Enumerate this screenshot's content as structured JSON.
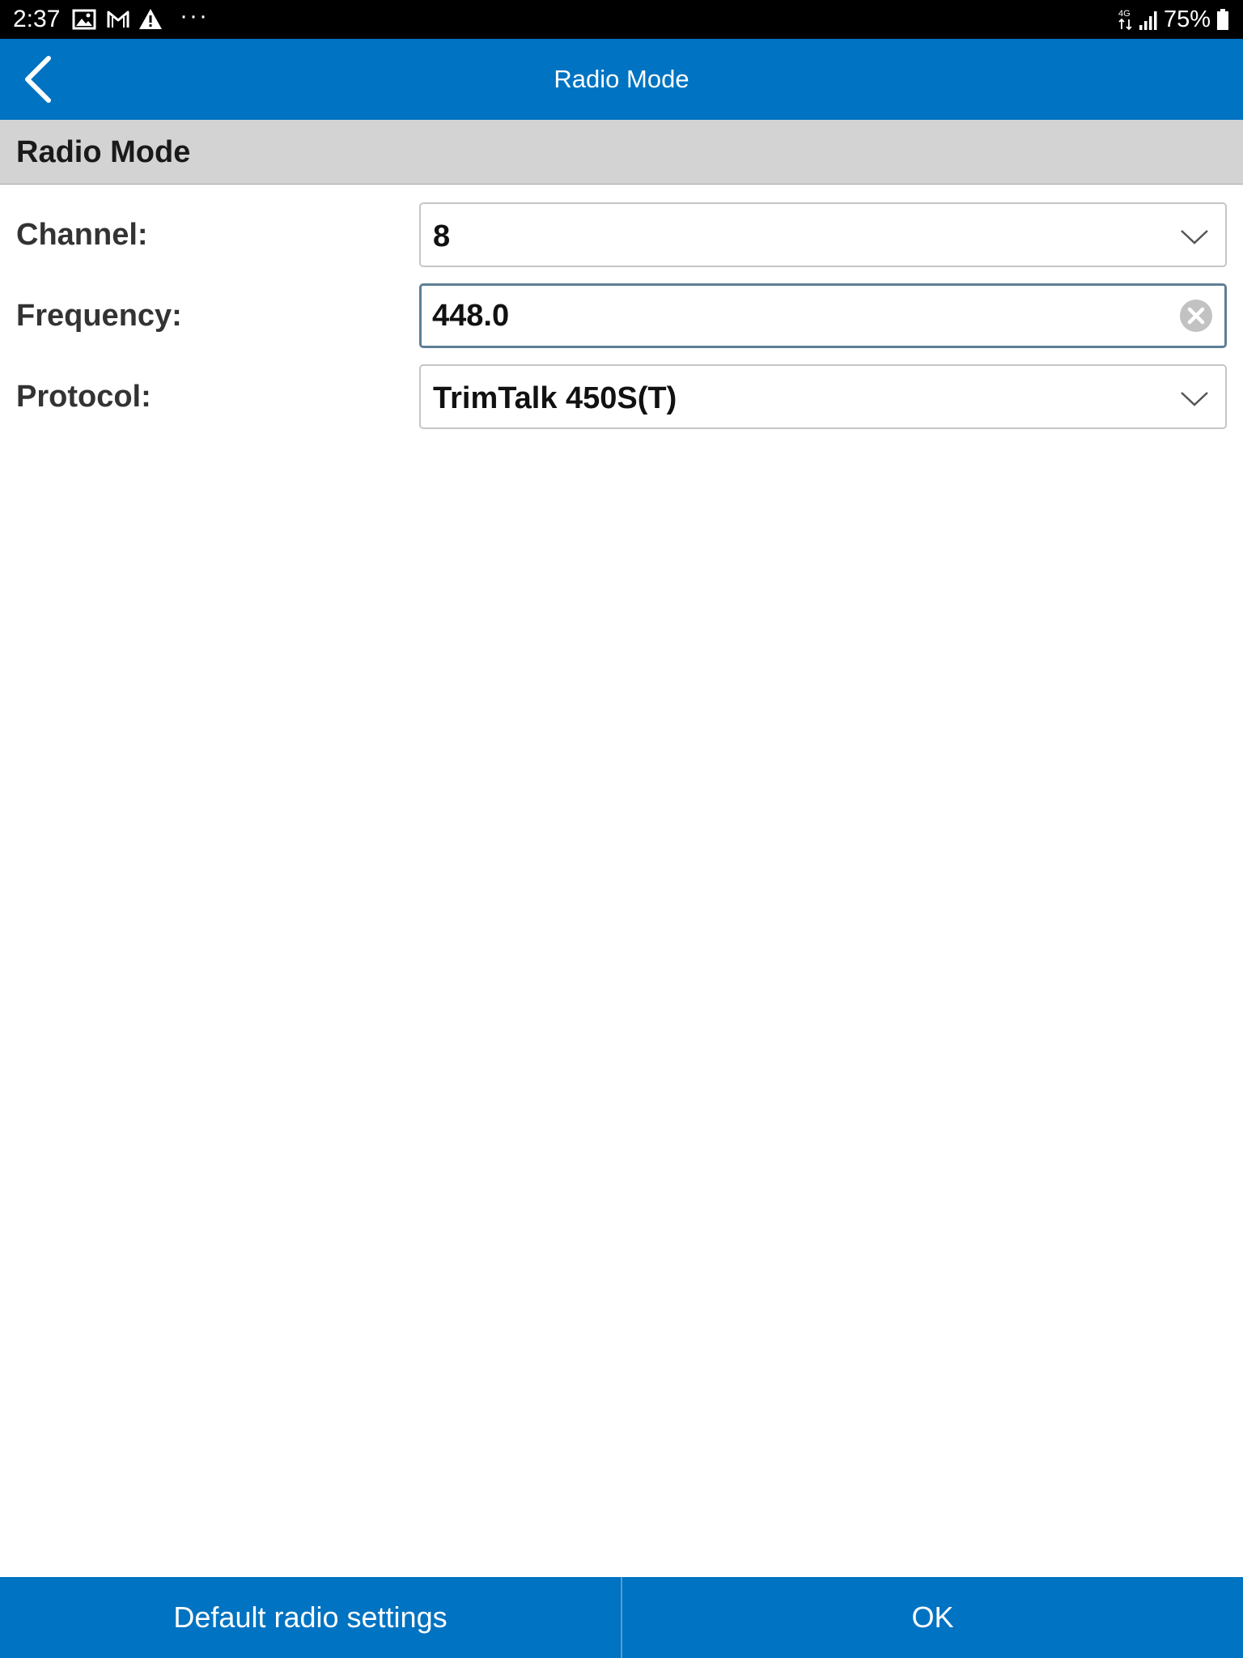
{
  "status_bar": {
    "time": "2:37",
    "more_indicator": "···",
    "network": "4G",
    "battery": "75%"
  },
  "app_bar": {
    "title": "Radio Mode",
    "back_icon": "chevron-left-icon"
  },
  "section": {
    "title": "Radio Mode"
  },
  "form": {
    "channel": {
      "label": "Channel:",
      "value": "8"
    },
    "frequency": {
      "label": "Frequency:",
      "value": "448.0"
    },
    "protocol": {
      "label": "Protocol:",
      "value": "TrimTalk 450S(T)"
    }
  },
  "footer": {
    "default_label": "Default radio settings",
    "ok_label": "OK"
  },
  "colors": {
    "accent": "#0073c2",
    "section_bg": "#d3d3d3",
    "status_bar": "#000000"
  }
}
